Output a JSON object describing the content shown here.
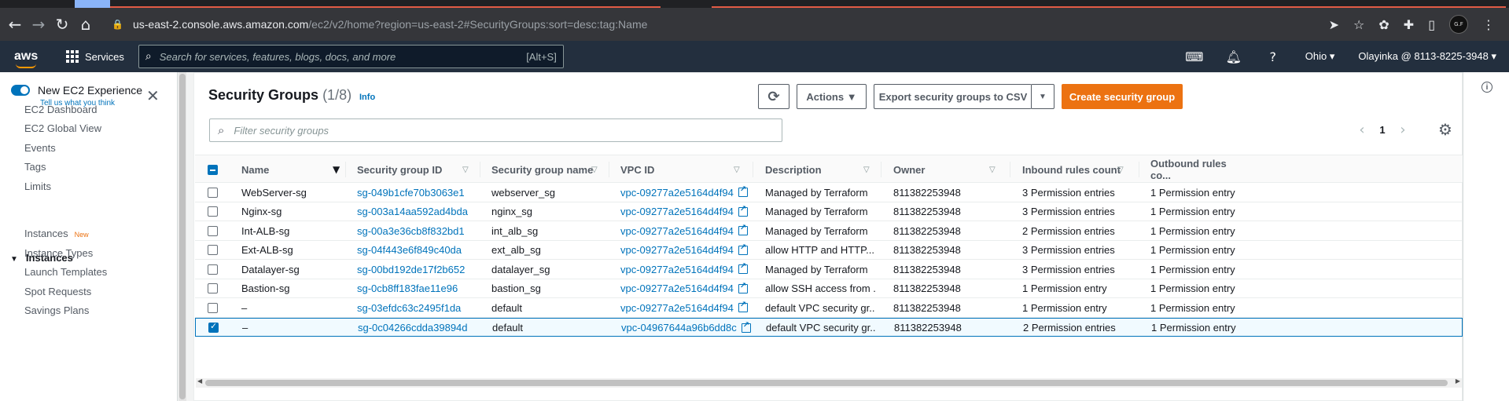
{
  "browser": {
    "url_host": "us-east-2.console.aws.amazon.com",
    "url_path": "/ec2/v2/home?region=us-east-2#SecurityGroups:sort=desc:tag:Name",
    "profile_initials": "G.F"
  },
  "aws_nav": {
    "logo": "aws",
    "services_label": "Services",
    "search_placeholder": "Search for services, features, blogs, docs, and more",
    "search_shortcut": "[Alt+S]",
    "region": "Ohio ▾",
    "account": "Olayinka @ 8113-8225-3948 ▾"
  },
  "sidebar": {
    "toggle_label": "New EC2 Experience",
    "toggle_link": "Tell us what you think",
    "items": [
      "EC2 Dashboard",
      "EC2 Global View",
      "Events",
      "Tags",
      "Limits"
    ],
    "section": "Instances",
    "section_items": [
      "Instances",
      "Instance Types",
      "Launch Templates",
      "Spot Requests",
      "Savings Plans"
    ],
    "new_badge": "New"
  },
  "main": {
    "title": "Security Groups",
    "count": "(1/8)",
    "info": "Info",
    "refresh_label": "⟳",
    "actions_label": "Actions ▼",
    "export_label": "Export security groups to CSV",
    "export_caret": "▼",
    "create_label": "Create security group",
    "filter_placeholder": "Filter security groups",
    "page_number": "1"
  },
  "table": {
    "columns": [
      "Name",
      "Security group ID",
      "Security group name",
      "VPC ID",
      "Description",
      "Owner",
      "Inbound rules count",
      "Outbound rules co..."
    ],
    "rows": [
      {
        "name": "WebServer-sg",
        "id": "sg-049b1cfe70b3063e1",
        "group_name": "webserver_sg",
        "vpc": "vpc-09277a2e5164d4f94",
        "desc": "Managed by Terraform",
        "owner": "811382253948",
        "inbound": "3 Permission entries",
        "outbound": "1 Permission entry",
        "selected": false
      },
      {
        "name": "Nginx-sg",
        "id": "sg-003a14aa592ad4bda",
        "group_name": "nginx_sg",
        "vpc": "vpc-09277a2e5164d4f94",
        "desc": "Managed by Terraform",
        "owner": "811382253948",
        "inbound": "3 Permission entries",
        "outbound": "1 Permission entry",
        "selected": false
      },
      {
        "name": "Int-ALB-sg",
        "id": "sg-00a3e36cb8f832bd1",
        "group_name": "int_alb_sg",
        "vpc": "vpc-09277a2e5164d4f94",
        "desc": "Managed by Terraform",
        "owner": "811382253948",
        "inbound": "2 Permission entries",
        "outbound": "1 Permission entry",
        "selected": false
      },
      {
        "name": "Ext-ALB-sg",
        "id": "sg-04f443e6f849c40da",
        "group_name": "ext_alb_sg",
        "vpc": "vpc-09277a2e5164d4f94",
        "desc": "allow HTTP and HTTP...",
        "owner": "811382253948",
        "inbound": "3 Permission entries",
        "outbound": "1 Permission entry",
        "selected": false
      },
      {
        "name": "Datalayer-sg",
        "id": "sg-00bd192de17f2b652",
        "group_name": "datalayer_sg",
        "vpc": "vpc-09277a2e5164d4f94",
        "desc": "Managed by Terraform",
        "owner": "811382253948",
        "inbound": "3 Permission entries",
        "outbound": "1 Permission entry",
        "selected": false
      },
      {
        "name": "Bastion-sg",
        "id": "sg-0cb8ff183fae11e96",
        "group_name": "bastion_sg",
        "vpc": "vpc-09277a2e5164d4f94",
        "desc": "allow SSH access from ...",
        "owner": "811382253948",
        "inbound": "1 Permission entry",
        "outbound": "1 Permission entry",
        "selected": false
      },
      {
        "name": "–",
        "id": "sg-03efdc63c2495f1da",
        "group_name": "default",
        "vpc": "vpc-09277a2e5164d4f94",
        "desc": "default VPC security gr...",
        "owner": "811382253948",
        "inbound": "1 Permission entry",
        "outbound": "1 Permission entry",
        "selected": false
      },
      {
        "name": "–",
        "id": "sg-0c04266cdda39894d",
        "group_name": "default",
        "vpc": "vpc-04967644a96b6dd8c",
        "desc": "default VPC security gr...",
        "owner": "811382253948",
        "inbound": "2 Permission entries",
        "outbound": "1 Permission entry",
        "selected": true
      }
    ]
  },
  "colors": {
    "aws_nav": "#232f3e",
    "link": "#0073bb",
    "primary": "#ec7211"
  }
}
